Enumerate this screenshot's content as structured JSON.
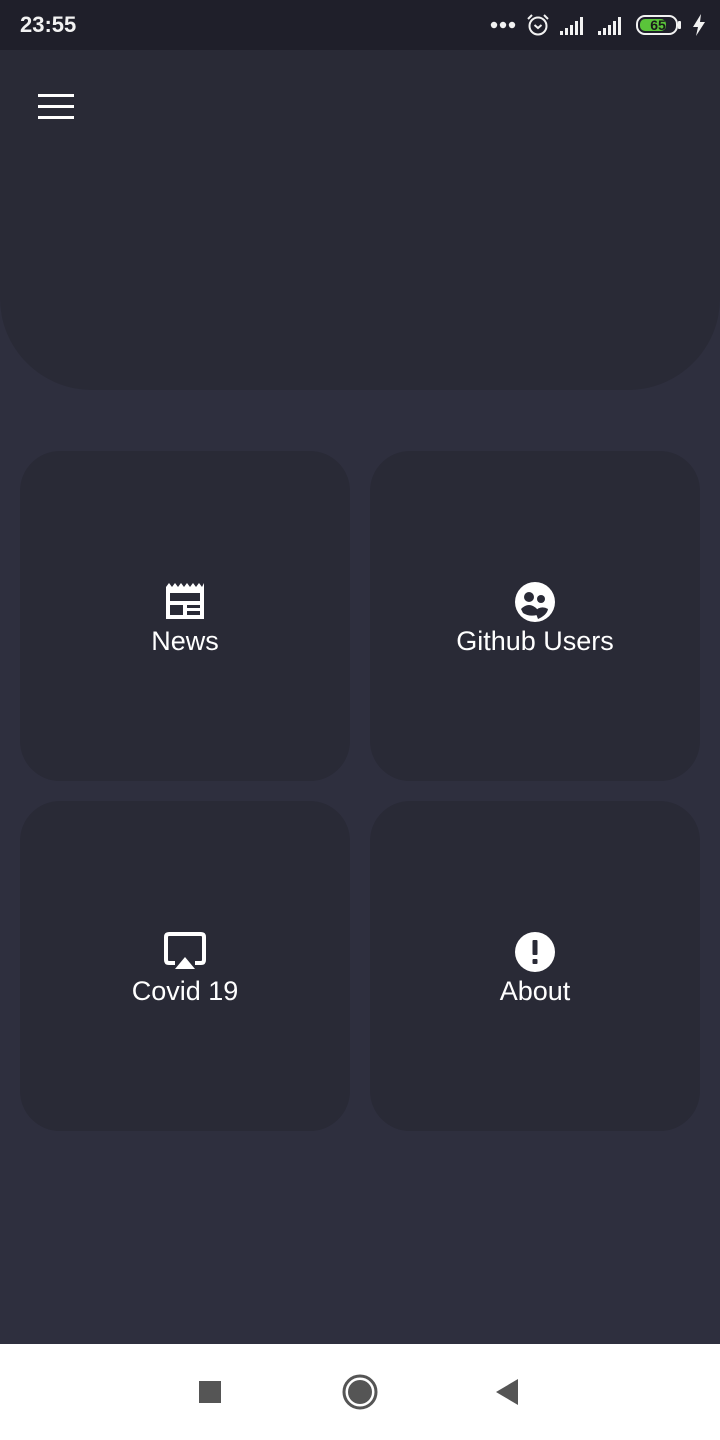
{
  "status_bar": {
    "time": "23:55",
    "battery_level": "65",
    "icons": [
      "more-dots-icon",
      "alarm-icon",
      "signal-icon",
      "signal-icon",
      "battery-icon",
      "charging-bolt-icon"
    ]
  },
  "header": {
    "menu_icon": "hamburger-menu-icon"
  },
  "tiles": [
    {
      "label": "News",
      "icon": "newspaper-icon"
    },
    {
      "label": "Github Users",
      "icon": "users-icon"
    },
    {
      "label": "Covid 19",
      "icon": "airplay-icon"
    },
    {
      "label": "About",
      "icon": "info-exclamation-icon"
    }
  ],
  "nav_bar": {
    "icons": [
      "recents-square-icon",
      "home-circle-icon",
      "back-triangle-icon"
    ]
  },
  "colors": {
    "background": "#2e2f3e",
    "surface": "#292a36",
    "status_bar": "#1f1f2a",
    "battery_fill": "#5ac43a",
    "text": "#ffffff"
  }
}
